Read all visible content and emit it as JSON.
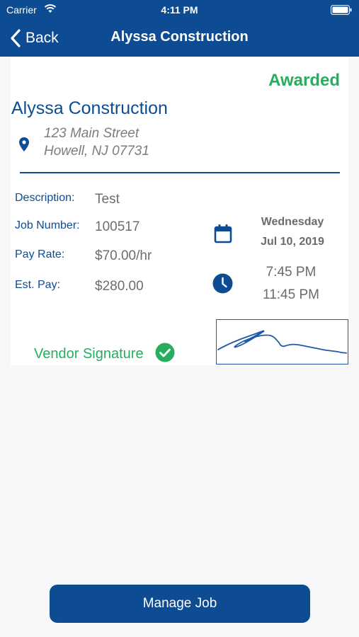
{
  "status_bar": {
    "carrier": "Carrier",
    "time": "4:11 PM"
  },
  "nav": {
    "back_label": "Back",
    "title": "Alyssa Construction"
  },
  "job": {
    "status": "Awarded",
    "status_color": "#27ad5f",
    "company": "Alyssa Construction",
    "address_line_1": "123 Main Street",
    "address_line_2": "Howell, NJ 07731",
    "fields": {
      "description_label": "Description:",
      "description_value": "Test",
      "job_number_label": "Job Number:",
      "job_number_value": "100517",
      "pay_rate_label": "Pay Rate:",
      "pay_rate_value": "$70.00/hr",
      "est_pay_label": "Est. Pay:",
      "est_pay_value": "$280.00"
    },
    "schedule": {
      "weekday": "Wednesday",
      "date": "Jul 10, 2019",
      "start_time": "7:45 PM",
      "end_time": "11:45 PM"
    },
    "vendor_signature_label": "Vendor Signature"
  },
  "actions": {
    "manage_job_label": "Manage Job"
  },
  "colors": {
    "brand": "#0d4c93",
    "success": "#27ad5f"
  },
  "icons": [
    "wifi-icon",
    "battery-icon",
    "back-chevron-icon",
    "location-pin-icon",
    "calendar-icon",
    "clock-icon",
    "checkmark-icon"
  ]
}
